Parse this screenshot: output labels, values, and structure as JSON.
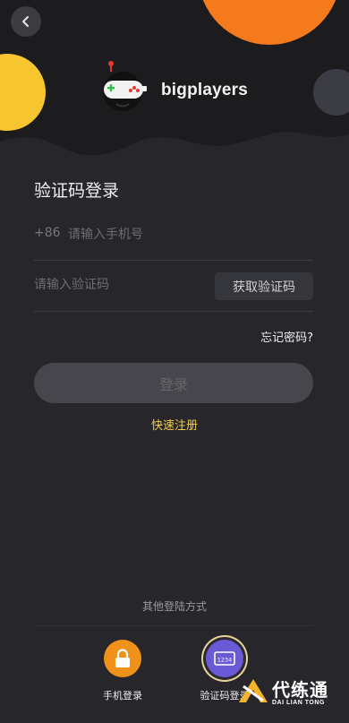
{
  "header": {
    "back_icon": "chevron-left-icon",
    "brand_name": "bigplayers",
    "logo_icon": "game-mascot-logo"
  },
  "form": {
    "title": "验证码登录",
    "phone_prefix": "+86",
    "phone_placeholder": "请输入手机号",
    "code_placeholder": "请输入验证码",
    "get_code_label": "获取验证码",
    "forgot_label": "忘记密码?",
    "login_label": "登录",
    "register_label": "快速注册"
  },
  "other_login": {
    "title": "其他登陆方式",
    "methods": [
      {
        "label": "手机登录",
        "icon": "lock-icon",
        "color": "#f0921a"
      },
      {
        "label": "验证码登录",
        "icon": "keypad-icon",
        "color": "#6b5ad6"
      }
    ]
  },
  "watermark": {
    "text": "代练通",
    "sub": "DAI LIAN TONG"
  },
  "colors": {
    "background": "#26262b",
    "accent_yellow": "#f5d04a",
    "orange": "#f0921a",
    "purple": "#6b5ad6"
  }
}
